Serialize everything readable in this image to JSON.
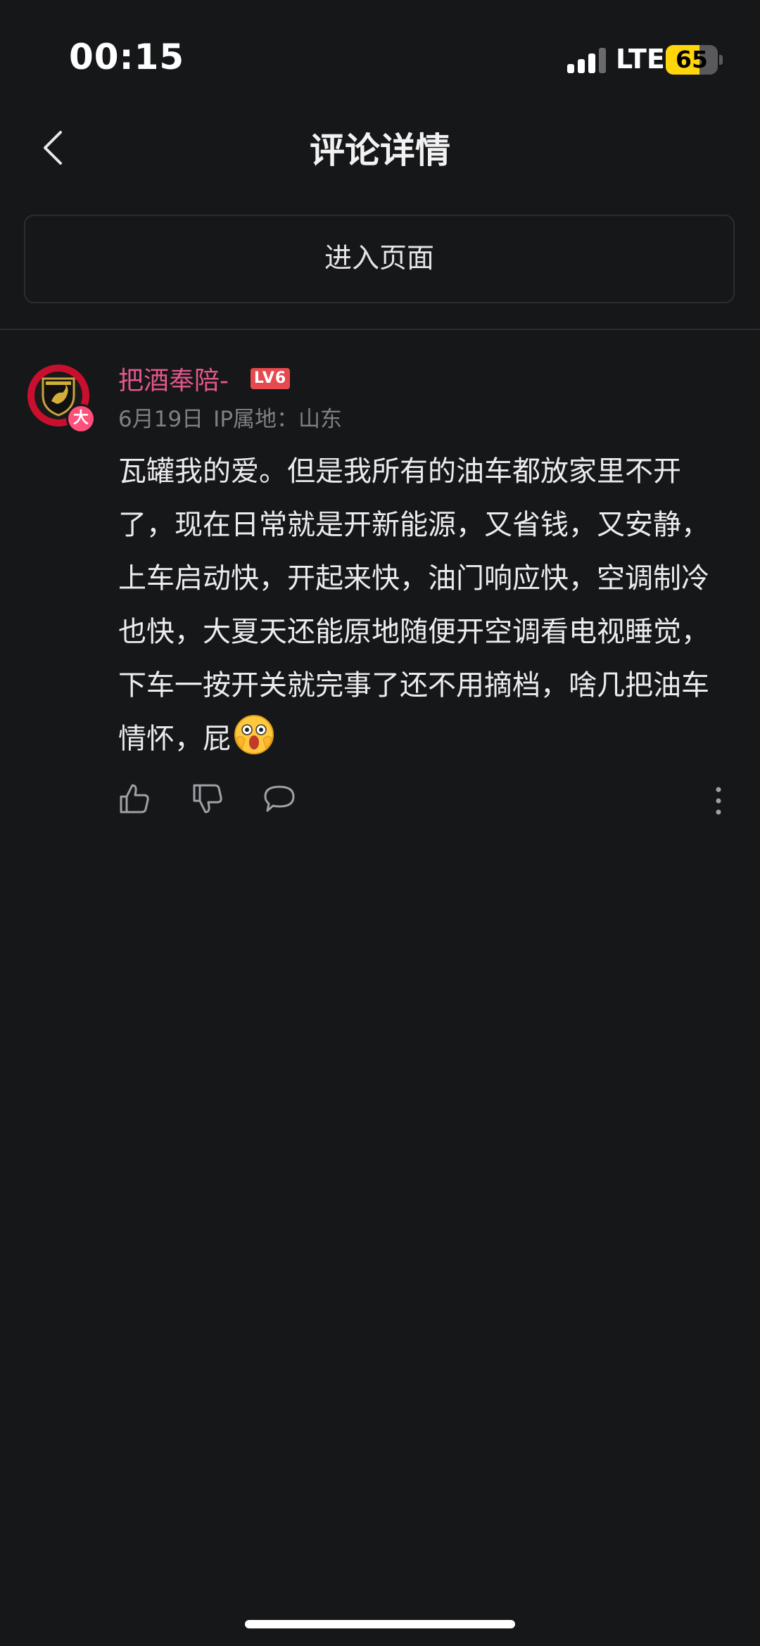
{
  "status_bar": {
    "time": "00:15",
    "network": "LTE",
    "battery_level": "65",
    "battery_fraction": 0.65,
    "signal_bars_active": 3,
    "signal_bars_total": 4
  },
  "nav": {
    "title": "评论详情",
    "back_icon": "chevron-left-icon"
  },
  "enter_page": {
    "label": "进入页面"
  },
  "comment": {
    "username": "把酒奉陪-",
    "level": "LV6",
    "badge": "大",
    "date": "6月19日",
    "ip_location": "IP属地：山东",
    "text": "瓦罐我的爱。但是我所有的油车都放家里不开了，现在日常就是开新能源，又省钱，又安静，上车启动快，开起来快，油门响应快，空调制冷也快，大夏天还能原地随便开空调看电视睡觉，下车一按开关就完事了还不用摘档，啥几把油车情怀，屁",
    "avatar_icon": "lamborghini-logo-icon",
    "emoji_icon": "shocked-face-emoji-icon"
  },
  "actions": {
    "like_icon": "thumbs-up-icon",
    "dislike_icon": "thumbs-down-icon",
    "reply_icon": "speech-bubble-icon",
    "more_icon": "more-vertical-icon"
  },
  "colors": {
    "background": "#161719",
    "username": "#e3578c",
    "level_badge": "#e64a4f",
    "meta": "#7f8085",
    "battery": "#ffd60a"
  }
}
